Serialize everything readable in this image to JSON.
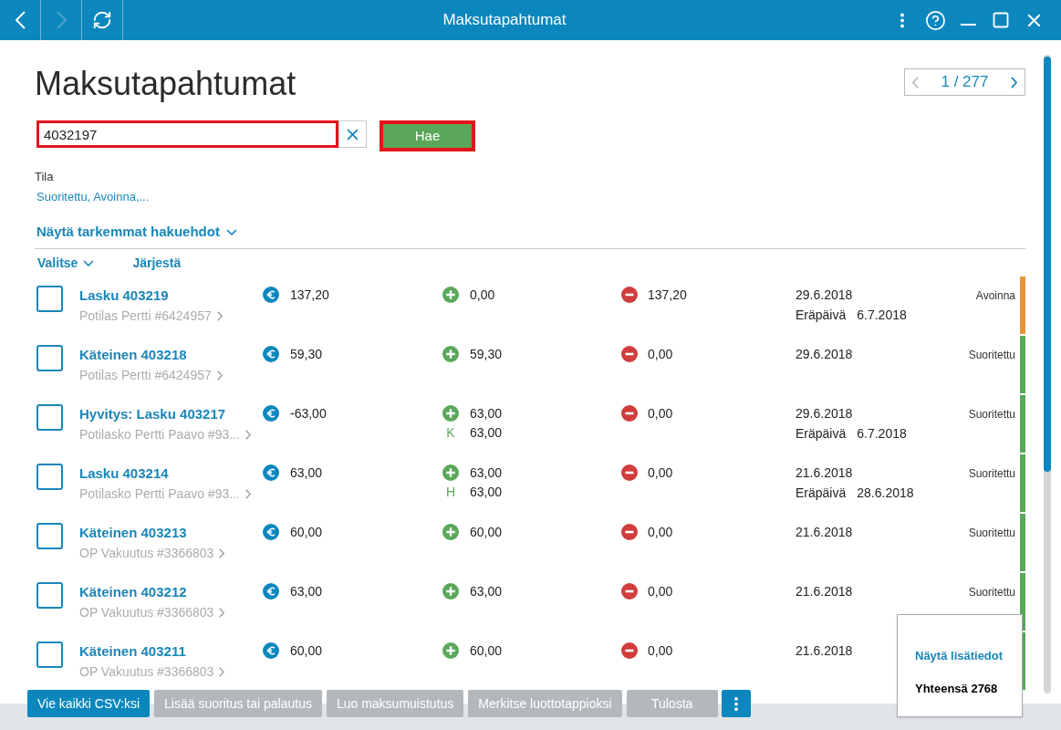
{
  "window": {
    "title": "Maksutapahtumat"
  },
  "nav_buttons": [
    {
      "kind": "back",
      "disabled": false
    },
    {
      "kind": "forward",
      "disabled": true
    },
    {
      "kind": "refresh",
      "disabled": false
    }
  ],
  "page": {
    "title": "Maksutapahtumat",
    "pager": {
      "label": "1 / 277",
      "prev_disabled": true,
      "next_disabled": false
    }
  },
  "search": {
    "value": "4032197",
    "button": "Hae"
  },
  "filter": {
    "label": "Tila",
    "value": "Suoritettu, Avoinna,..."
  },
  "advanced_toggle": {
    "label": "Näytä tarkemmat hakuehdot",
    "expanded": false
  },
  "list_actions": [
    {
      "label": "Valitse",
      "dropdown": true
    },
    {
      "label": "Järjestä",
      "dropdown": false
    }
  ],
  "rows": [
    {
      "checked": false,
      "title": "Lasku 403219",
      "customer": "Potilas Pertti #6424957",
      "total": "137,20",
      "paid": "0,00",
      "remaining": "137,20",
      "date": "29.6.2018",
      "due": {
        "label": "Eräpäivä",
        "date": "6.7.2018"
      },
      "status": "Avoinna",
      "color": "#e8953a"
    },
    {
      "checked": false,
      "title": "Käteinen 403218",
      "customer": "Potilas Pertti #6424957",
      "total": "59,30",
      "paid": "59,30",
      "remaining": "0,00",
      "date": "29.6.2018",
      "status": "Suoritettu",
      "color": "#5ba85a"
    },
    {
      "checked": false,
      "title": "Hyvitys: Lasku 403217",
      "customer": "Potilasko Pertti Paavo #93...",
      "total": "-63,00",
      "paid": "63,00",
      "paid_detail": {
        "code": "K",
        "amount": "63,00"
      },
      "remaining": "0,00",
      "date": "29.6.2018",
      "due": {
        "label": "Eräpäivä",
        "date": "6.7.2018"
      },
      "status": "Suoritettu",
      "color": "#5ba85a"
    },
    {
      "checked": false,
      "title": "Lasku 403214",
      "customer": "Potilasko Pertti Paavo #93...",
      "total": "63,00",
      "paid": "63,00",
      "paid_detail": {
        "code": "H",
        "amount": "63,00"
      },
      "remaining": "0,00",
      "date": "21.6.2018",
      "due": {
        "label": "Eräpäivä",
        "date": "28.6.2018"
      },
      "status": "Suoritettu",
      "color": "#5ba85a"
    },
    {
      "checked": false,
      "title": "Käteinen 403213",
      "customer": "OP Vakuutus #3366803",
      "total": "60,00",
      "paid": "60,00",
      "remaining": "0,00",
      "date": "21.6.2018",
      "status": "Suoritettu",
      "color": "#5ba85a"
    },
    {
      "checked": false,
      "title": "Käteinen 403212",
      "customer": "OP Vakuutus #3366803",
      "total": "63,00",
      "paid": "63,00",
      "remaining": "0,00",
      "date": "21.6.2018",
      "status": "Suoritettu",
      "color": "#5ba85a"
    },
    {
      "checked": false,
      "title": "Käteinen 403211",
      "customer": "OP Vakuutus #3366803",
      "total": "60,00",
      "paid": "60,00",
      "remaining": "0,00",
      "date": "21.6.2018",
      "color": "#5ba85a"
    }
  ],
  "footer_buttons": [
    {
      "label": "Vie kaikki CSV:ksi",
      "disabled": false
    },
    {
      "label": "Lisää suoritus tai palautus",
      "disabled": true
    },
    {
      "label": "Luo maksumuistutus",
      "disabled": true
    },
    {
      "label": "Merkitse luottotappioksi",
      "disabled": true
    },
    {
      "label": "Tulosta",
      "disabled": true
    }
  ],
  "summary_panel": {
    "link": "Näytä lisätiedot",
    "total": "Yhteensä 2768"
  }
}
